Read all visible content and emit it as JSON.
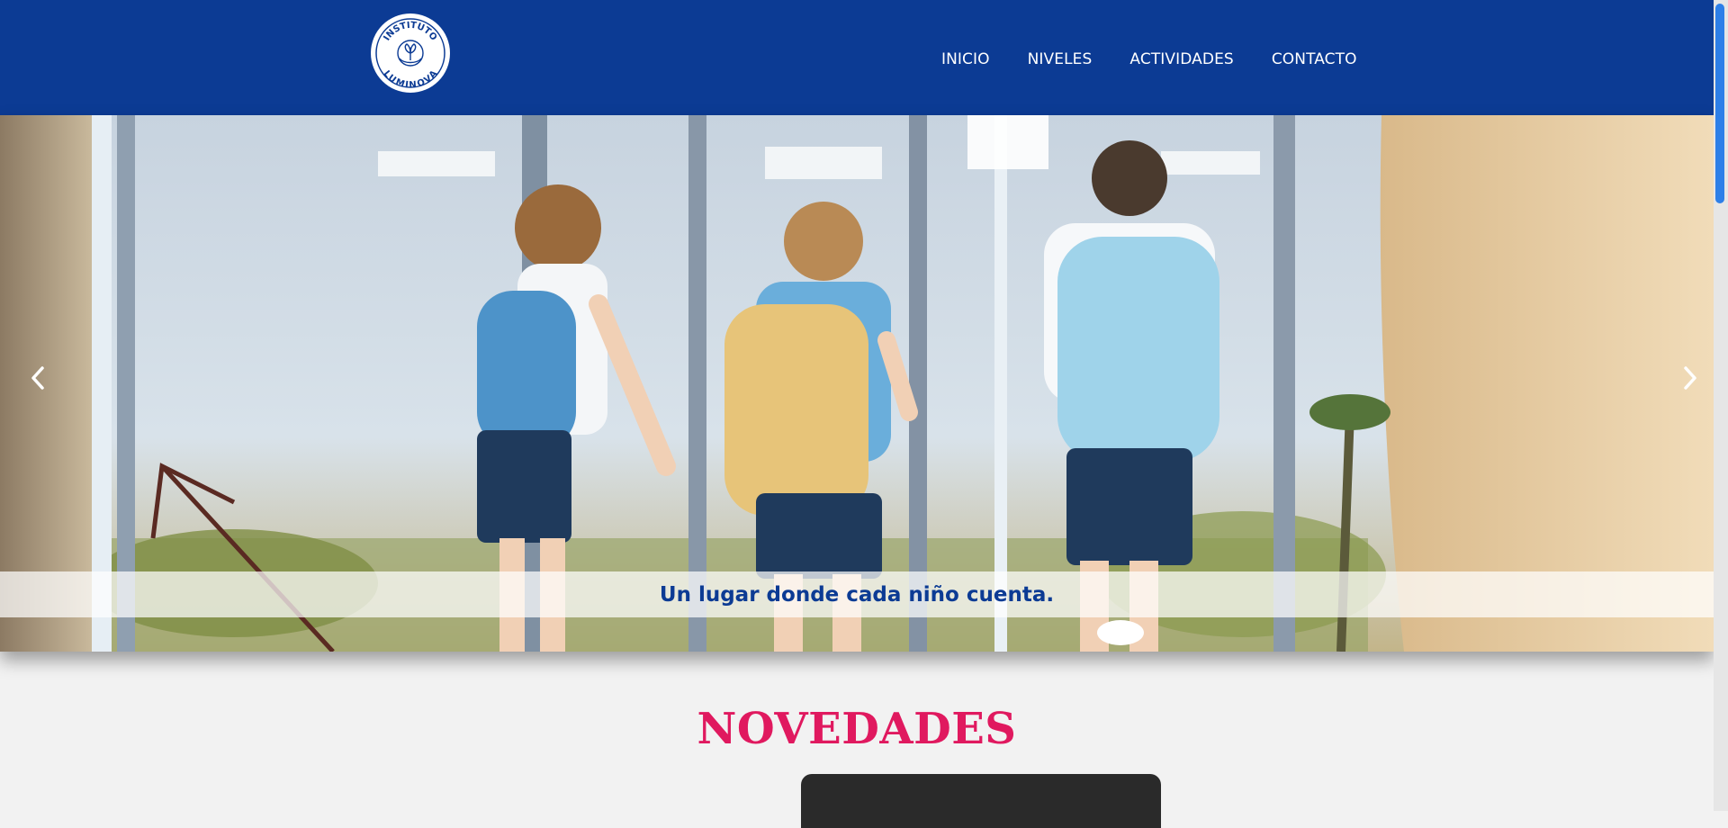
{
  "brand": {
    "logo_line1": "INSTITUTO",
    "logo_line2": "LUMINOVA",
    "logo_icon": "hands-holding-plant-icon"
  },
  "nav": {
    "items": [
      "INICIO",
      "NIVELES",
      "ACTIVIDADES",
      "CONTACTO"
    ]
  },
  "hero": {
    "caption": "Un lugar donde cada niño cuenta.",
    "prev_icon": "chevron-left-icon",
    "next_icon": "chevron-right-icon"
  },
  "news": {
    "title": "NOVEDADES"
  },
  "colors": {
    "header_bg": "#0c3b94",
    "accent": "#e0195f",
    "page_bg": "#f2f2f2",
    "scroll_thumb": "#2d7fe8"
  }
}
